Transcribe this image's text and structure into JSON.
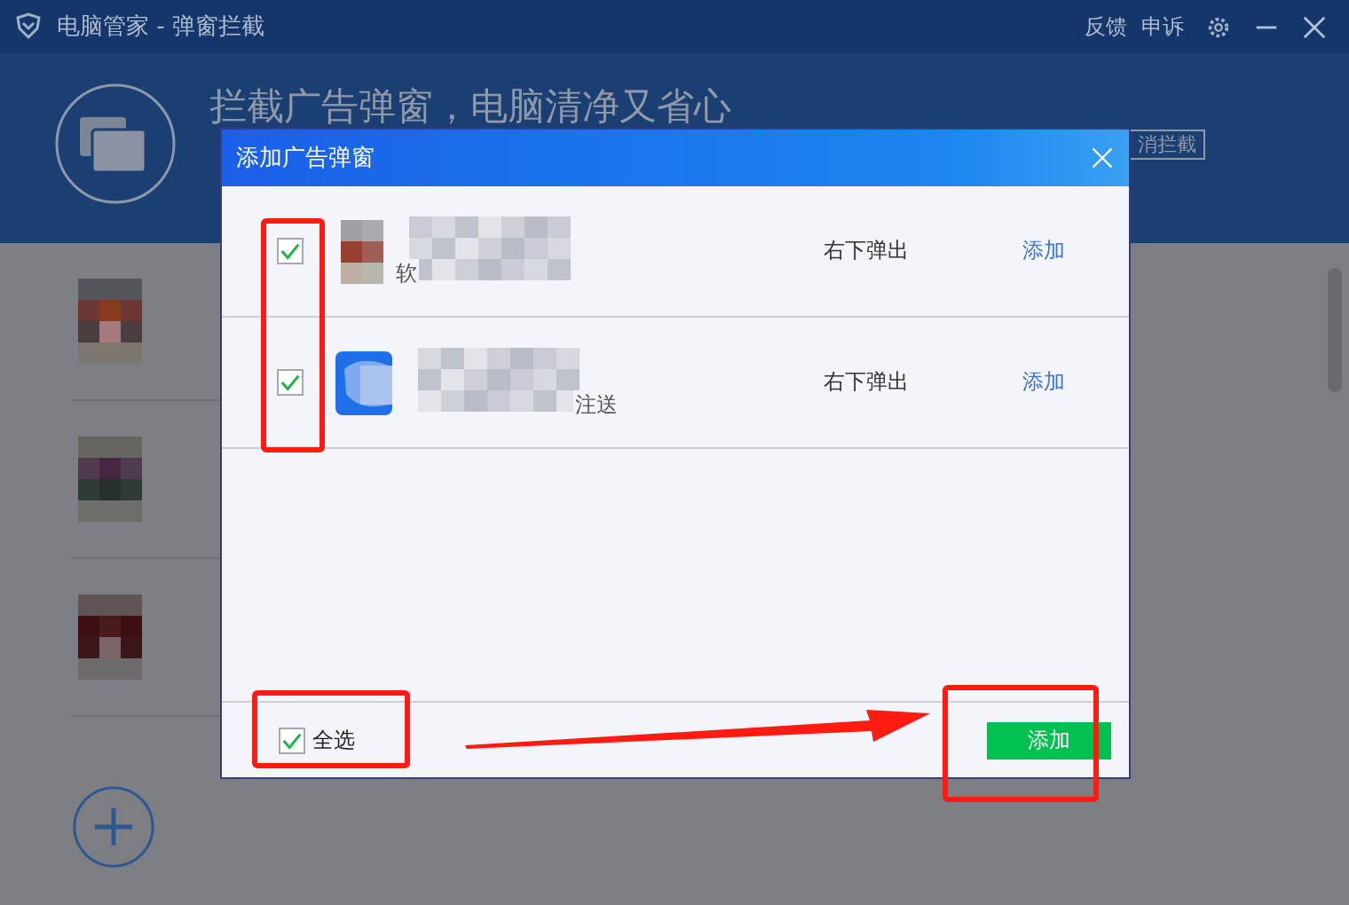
{
  "window": {
    "title": "电脑管家 - 弹窗拦截",
    "actions": [
      "反馈",
      "申诉"
    ]
  },
  "header": {
    "headline": "拦截广告弹窗，电脑清净又省心",
    "button": "消拦截"
  },
  "dialog": {
    "title": "添加广告弹窗",
    "rows": [
      {
        "checked": true,
        "kind": "picture",
        "name_fragment": "软",
        "position": "右下弹出",
        "action": "添加"
      },
      {
        "checked": true,
        "kind": "picture",
        "name_fragment": "注送",
        "position": "右下弹出",
        "action": "添加"
      }
    ],
    "select_all": {
      "label": "全选",
      "checked": true
    },
    "add_button": "添加"
  }
}
